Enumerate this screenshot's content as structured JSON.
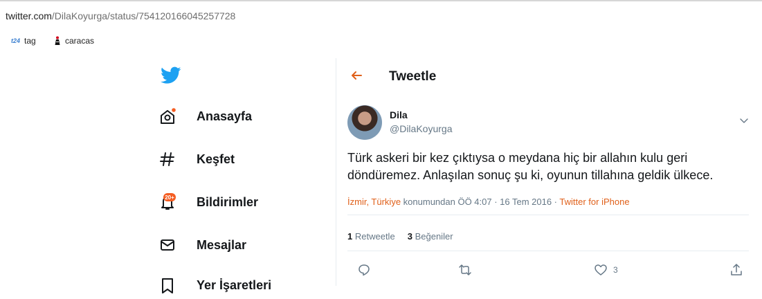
{
  "browser": {
    "url_domain": "twitter.com",
    "url_path": "/DilaKoyurga/status/754120166045257728"
  },
  "bookmarks": [
    {
      "icon_text": "t24",
      "label": "tag"
    },
    {
      "label": "caracas"
    }
  ],
  "sidebar": {
    "items": [
      {
        "label": "Anasayfa",
        "icon": "home-icon"
      },
      {
        "label": "Keşfet",
        "icon": "hashtag-icon"
      },
      {
        "label": "Bildirimler",
        "icon": "bell-icon",
        "badge": "20+"
      },
      {
        "label": "Mesajlar",
        "icon": "envelope-icon"
      },
      {
        "label": "Yer İşaretleri",
        "icon": "bookmark-icon"
      }
    ]
  },
  "header": {
    "title": "Tweetle"
  },
  "tweet": {
    "author_name": "Dila",
    "author_handle": "@DilaKoyurga",
    "text": "Türk askeri bir kez çıktıysa o meydana hiç bir allahın kulu geri döndüremez. Anlaşılan sonuç şu ki, oyunun tillahına geldik ülkece.",
    "location": "İzmir, Türkiye",
    "location_suffix": " konumundan ÖÖ 4:07 · 16 Tem 2016 · ",
    "source": "Twitter for iPhone",
    "retweet_count": "1",
    "retweet_label": "Retweetle",
    "like_count": "3",
    "like_label": "Beğeniler",
    "like_action_count": "3"
  },
  "colors": {
    "accent": "#e0245e",
    "link_orange": "#e0601a",
    "twitter_blue": "#1da1f2",
    "muted": "#657786",
    "badge": "#f45d22"
  }
}
